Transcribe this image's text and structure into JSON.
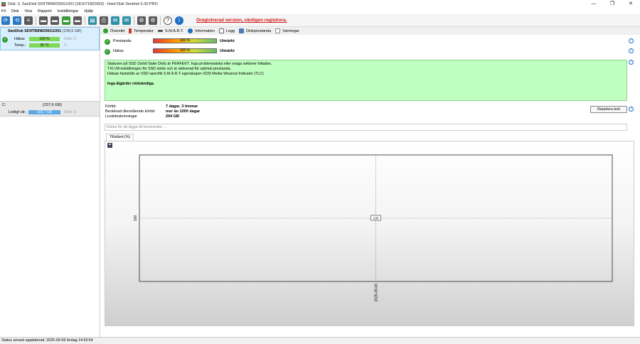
{
  "window": {
    "title": "Disk: 0, SanDisk SD9TB8W256G1001 [181071802993]  -  Hard Disk Sentinel 6.30 PRO",
    "controls": [
      "—",
      "❐",
      "✕"
    ]
  },
  "menu": [
    "Fil",
    "Disk",
    "Visa",
    "Rapport",
    "Inställningar",
    "Hjälp"
  ],
  "toolbar": {
    "unregistered": "Oregistrerad version, vänligen registrera."
  },
  "disk": {
    "name": "SanDisk SD9TB8W256G1001",
    "capacity": "(238,5 GB)",
    "health_label": "Hälsa:",
    "health_value": "100 %",
    "temp_label": "Temp.:",
    "temp_value": "39 °C",
    "disk_index_label": "Disk: 0",
    "drive_letter": "C:"
  },
  "volume": {
    "label": "C:",
    "size": "(237,6 GB)",
    "free_label": "Ledigt utr.:",
    "free_value": "165,7 GB",
    "disk_label": "Disk: 0"
  },
  "tabs": [
    "Översikt",
    "Temperatur",
    "S.M.A.R.T.",
    "Information",
    "Logg",
    "Diskprestanda",
    "Varningar"
  ],
  "overview": {
    "performance_label": "Prestanda:",
    "performance_value": "100 %",
    "performance_rating": "Utmärkt",
    "health_label": "Hälsa:",
    "health_value": "100 %",
    "health_rating": "Utmärkt",
    "status_lines": [
      "Statusen på SSD (Solid State Disk) är PERFEKT. Inga problematiska eller svaga sektorer hittades.",
      "T.R.I.M-inställningen för SSD stöds och är aktiverad för optimal prestanda.",
      "Hälsan fastställs av SSD-specifik S.M.A.R.T-egenskaper  #233 Media Wearout Indicator (TLC)"
    ],
    "status_bold": "Inga åtgärder nödvändiga.",
    "runtime_label": "Körtid:",
    "runtime_value": "7 dagar, 3 timmar",
    "remaining_label": "Beräknad återstående körtid:",
    "remaining_value": "mer än 1000 dagar",
    "writes_label": "Livstidsskrivningar",
    "writes_value": "294 GB",
    "repeat_button": "Repetera test",
    "comment_placeholder": "Klicka för att lägga till kommentar ..."
  },
  "chart_tab": "Tillstånd (%)",
  "chart_data": {
    "type": "line",
    "x": [
      "2025-09-06"
    ],
    "y": [
      100
    ],
    "data_labels": [
      "100"
    ],
    "y_tick_labels": [
      "100"
    ],
    "x_tick_labels": [
      "2025-09-06"
    ],
    "grid": true
  },
  "statusbar": "Status senast uppdaterad: 2025-09-06 lördag 14:53:54"
}
